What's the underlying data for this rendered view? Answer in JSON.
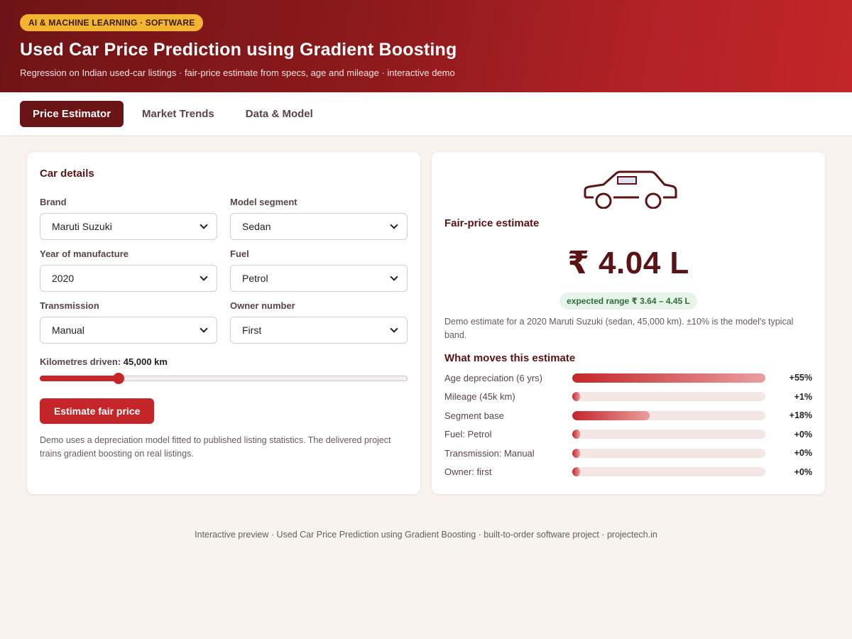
{
  "header": {
    "badge": "AI & MACHINE LEARNING · SOFTWARE",
    "title": "Used Car Price Prediction using Gradient Boosting",
    "subtitle": "Regression on Indian used-car listings · fair-price estimate from specs, age and mileage · interactive demo"
  },
  "tabs": [
    {
      "label": "Price Estimator",
      "active": true
    },
    {
      "label": "Market Trends",
      "active": false
    },
    {
      "label": "Data & Model",
      "active": false
    }
  ],
  "form": {
    "title": "Car details",
    "brand": {
      "label": "Brand",
      "value": "Maruti Suzuki"
    },
    "segment": {
      "label": "Model segment",
      "value": "Sedan"
    },
    "year": {
      "label": "Year of manufacture",
      "value": "2020"
    },
    "fuel": {
      "label": "Fuel",
      "value": "Petrol"
    },
    "transmission": {
      "label": "Transmission",
      "value": "Manual"
    },
    "owner": {
      "label": "Owner number",
      "value": "First"
    },
    "km": {
      "label": "Kilometres driven:",
      "value": "45,000 km",
      "fraction": 0.215
    },
    "button": "Estimate fair price",
    "note": "Demo uses a depreciation model fitted to published listing statistics. The delivered project trains gradient boosting on real listings."
  },
  "result": {
    "car_icon": "car-outline-icon",
    "title": "Fair-price estimate",
    "price": "₹ 4.04 L",
    "range": "expected range ₹ 3.64 – 4.45 L",
    "note": "Demo estimate for a 2020 Maruti Suzuki (sedan, 45,000 km). ±10% is the model's typical band.",
    "moves_title": "What moves this estimate",
    "factors": [
      {
        "label": "Age depreciation (6 yrs)",
        "value": "+55%",
        "fraction": 1.0
      },
      {
        "label": "Mileage (45k km)",
        "value": "+1%",
        "fraction": 0.04
      },
      {
        "label": "Segment base",
        "value": "+18%",
        "fraction": 0.4
      },
      {
        "label": "Fuel: Petrol",
        "value": "+0%",
        "fraction": 0.04
      },
      {
        "label": "Transmission: Manual",
        "value": "+0%",
        "fraction": 0.04
      },
      {
        "label": "Owner: first",
        "value": "+0%",
        "fraction": 0.04
      }
    ]
  },
  "footer": "Interactive preview · Used Car Price Prediction using Gradient Boosting · built-to-order software project · projectech.in",
  "colors": {
    "accent": "#c4262a",
    "header_dark": "#6e1416",
    "badge": "#f3b431",
    "range_bg": "#e7f4e9"
  }
}
